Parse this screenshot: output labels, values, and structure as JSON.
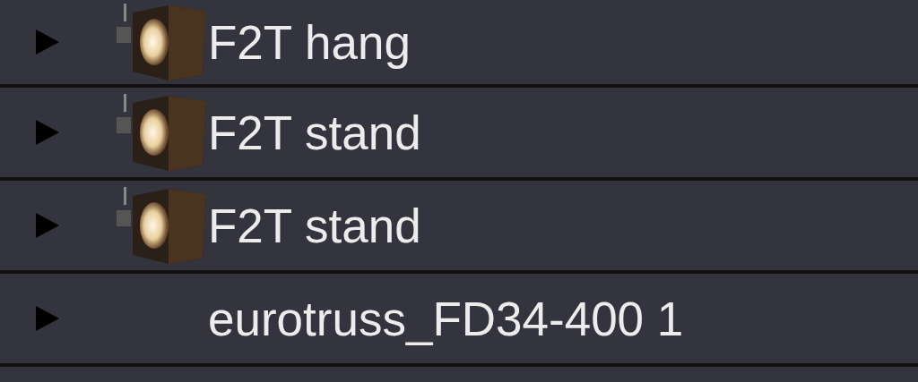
{
  "tree": {
    "items": [
      {
        "label": "F2T hang",
        "kind": "fixture",
        "expanded": false
      },
      {
        "label": "F2T stand",
        "kind": "fixture",
        "expanded": false
      },
      {
        "label": "F2T stand",
        "kind": "fixture",
        "expanded": false
      },
      {
        "label": "eurotruss_FD34-400 1",
        "kind": "truss",
        "expanded": false
      }
    ]
  }
}
